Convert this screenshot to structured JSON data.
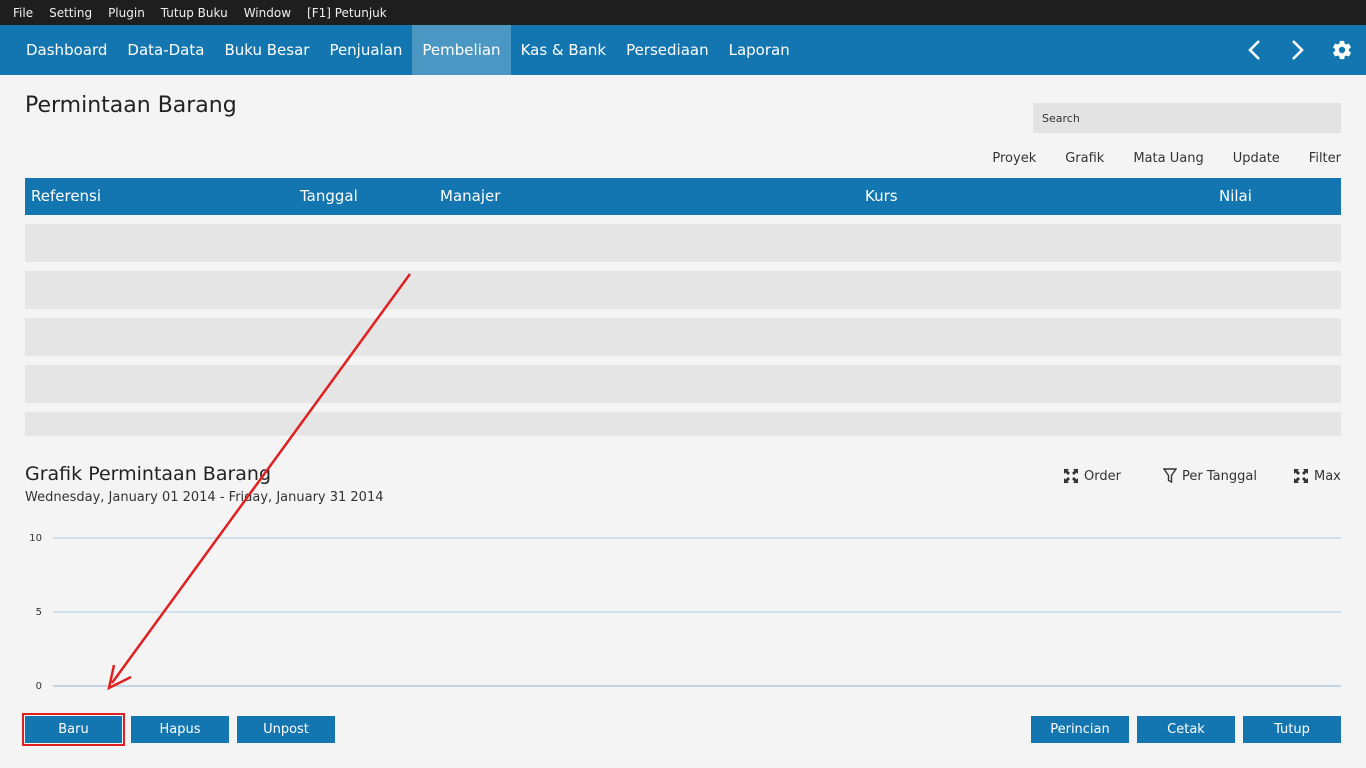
{
  "menubar": [
    "File",
    "Setting",
    "Plugin",
    "Tutup Buku",
    "Window",
    "[F1] Petunjuk"
  ],
  "navbar": {
    "tabs": [
      "Dashboard",
      "Data-Data",
      "Buku Besar",
      "Penjualan",
      "Pembelian",
      "Kas & Bank",
      "Persediaan",
      "Laporan"
    ],
    "active": "Pembelian",
    "icons": [
      "chevron-left-icon",
      "chevron-right-icon",
      "gear-icon"
    ]
  },
  "page": {
    "title": "Permintaan Barang",
    "search_placeholder": "Search"
  },
  "toolbar": {
    "proyek": "Proyek",
    "grafik": "Grafik",
    "mata_uang": "Mata Uang",
    "update": "Update",
    "filter": "Filter"
  },
  "table": {
    "columns": {
      "referensi": "Referensi",
      "tanggal": "Tanggal",
      "manajer": "Manajer",
      "kurs": "Kurs",
      "nilai": "Nilai"
    }
  },
  "chart_section": {
    "title": "Grafik Permintaan Barang",
    "date_range": "Wednesday, January 01 2014 - Friday, January 31 2014",
    "order": "Order",
    "per_tanggal": "Per Tanggal",
    "max": "Max"
  },
  "chart_data": {
    "type": "line",
    "series": [],
    "yticks": [
      "10",
      "5",
      "0"
    ],
    "ylim": [
      0,
      10
    ],
    "grid": true
  },
  "buttons": {
    "baru": "Baru",
    "hapus": "Hapus",
    "unpost": "Unpost",
    "perincian": "Perincian",
    "cetak": "Cetak",
    "tutup": "Tutup"
  },
  "colors": {
    "accent": "#1376b0",
    "active_tab": "#4a97c3",
    "annotation": "#e02020"
  }
}
